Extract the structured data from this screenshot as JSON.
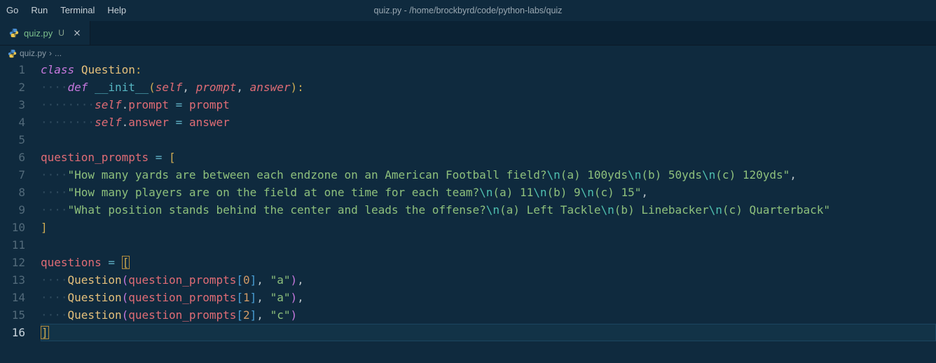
{
  "menubar": {
    "items": [
      "Go",
      "Run",
      "Terminal",
      "Help"
    ],
    "title": "quiz.py - /home/brockbyrd/code/python-labs/quiz"
  },
  "tab": {
    "filename": "quiz.py",
    "status": "U"
  },
  "breadcrumb": {
    "file": "quiz.py",
    "ellipsis": "..."
  },
  "code": {
    "lines": 16,
    "current_line": 16,
    "l7a": "\"How many yards are between each endzone on an American Football field?",
    "l7b": "(a) 100yds",
    "l7c": "(b) 50yds",
    "l7d": "(c) 120yds\"",
    "l8a": "\"How many players are on the field at one time for each team?",
    "l8b": "(a) 11",
    "l8c": "(b) 9",
    "l8d": "(c) 15\"",
    "l9a": "\"What position stands behind the center and leads the offense?",
    "l9b": "(a) Left Tackle",
    "l9c": "(b) Linebacker",
    "l9d": "(c) Quarterback\"",
    "esc": "\\n",
    "kw_class": "class",
    "kw_def": "def",
    "cls_Question": "Question",
    "fn_init": "__init__",
    "self": "self",
    "p_prompt": "prompt",
    "p_answer": "answer",
    "a_prompt": "prompt",
    "a_answer": "answer",
    "v_qp": "question_prompts",
    "v_qs": "questions",
    "eq": "=",
    "dot": ".",
    "col": ":",
    "com": ",",
    "lp": "(",
    "rp": ")",
    "lb": "[",
    "rb": "]",
    "n0": "0",
    "n1": "1",
    "n2": "2",
    "s_a": "\"a\"",
    "s_c": "\"c\"",
    "ln": [
      "1",
      "2",
      "3",
      "4",
      "5",
      "6",
      "7",
      "8",
      "9",
      "10",
      "11",
      "12",
      "13",
      "14",
      "15",
      "16"
    ]
  }
}
